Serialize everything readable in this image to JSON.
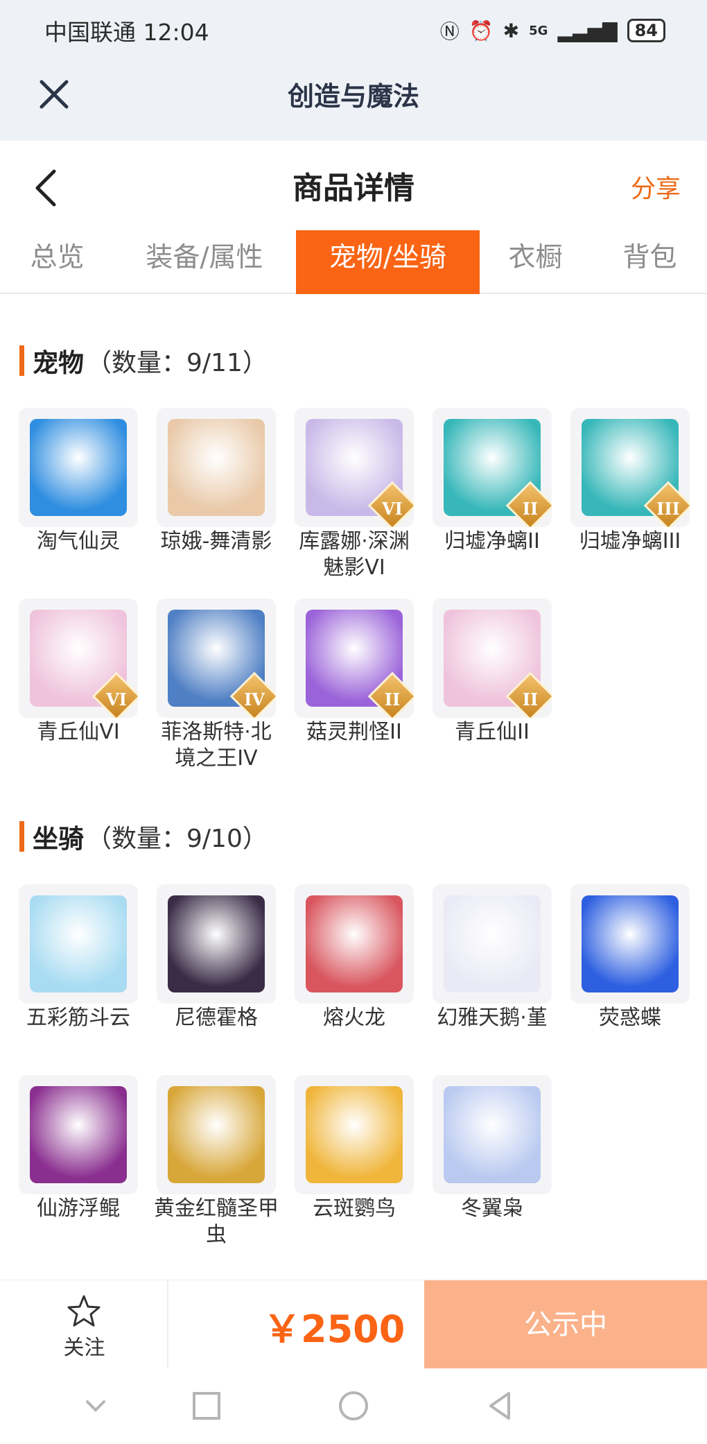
{
  "status_bar": {
    "carrier": "中国联通 12:04",
    "network": "5G",
    "battery": "84"
  },
  "webview": {
    "title": "创造与魔法"
  },
  "header": {
    "title": "商品详情",
    "share_label": "分享"
  },
  "tabs": [
    {
      "label": "总览",
      "active": false
    },
    {
      "label": "装备/属性",
      "active": false
    },
    {
      "label": "宠物/坐骑",
      "active": true
    },
    {
      "label": "衣橱",
      "active": false
    },
    {
      "label": "背包",
      "active": false
    }
  ],
  "pets": {
    "title": "宠物",
    "count": "（数量：9/11）",
    "items": [
      {
        "name": "淘气仙灵",
        "icon": "blue-puppy-icon",
        "color": "#2f8ee0",
        "tier": ""
      },
      {
        "name": "琼娥-舞清影",
        "icon": "fairy-girl-icon",
        "color": "#e9c9a8",
        "tier": ""
      },
      {
        "name": "库露娜·深渊魅影VI",
        "icon": "white-hair-girl-icon",
        "color": "#c9b9e8",
        "tier": "VI"
      },
      {
        "name": "归墟净螭II",
        "icon": "teal-dragon-icon",
        "color": "#37b7b9",
        "tier": "II"
      },
      {
        "name": "归墟净螭III",
        "icon": "teal-dragon-icon",
        "color": "#37b7b9",
        "tier": "III"
      },
      {
        "name": "青丘仙VI",
        "icon": "fox-girl-icon",
        "color": "#efc3dc",
        "tier": "VI"
      },
      {
        "name": "菲洛斯特·北境之王IV",
        "icon": "ice-dragon-icon",
        "color": "#4f7fc4",
        "tier": "IV"
      },
      {
        "name": "菇灵荆怪II",
        "icon": "purple-mushroom-icon",
        "color": "#9b63d9",
        "tier": "II"
      },
      {
        "name": "青丘仙II",
        "icon": "fox-girl-icon",
        "color": "#efc3dc",
        "tier": "II"
      }
    ]
  },
  "mounts": {
    "title": "坐骑",
    "count": "（数量：9/10）",
    "items": [
      {
        "name": "五彩筋斗云",
        "icon": "cloud-icon",
        "color": "#a9dcf2",
        "tier": ""
      },
      {
        "name": "尼德霍格",
        "icon": "black-dragon-icon",
        "color": "#3a2b46",
        "tier": ""
      },
      {
        "name": "熔火龙",
        "icon": "red-dragon-icon",
        "color": "#d9565f",
        "tier": ""
      },
      {
        "name": "幻雅天鹅·堇",
        "icon": "swan-icon",
        "color": "#e9eaf5",
        "tier": ""
      },
      {
        "name": "荧惑蝶",
        "icon": "blue-butterfly-icon",
        "color": "#2d5fe0",
        "tier": ""
      },
      {
        "name": "仙游浮鲲",
        "icon": "purple-fish-icon",
        "color": "#8a2f8f",
        "tier": ""
      },
      {
        "name": "黄金红髓圣甲虫",
        "icon": "golden-beetle-icon",
        "color": "#d8a73a",
        "tier": ""
      },
      {
        "name": "云斑鹦鸟",
        "icon": "parrot-icon",
        "color": "#f0b63c",
        "tier": ""
      },
      {
        "name": "冬翼枭",
        "icon": "snow-owl-icon",
        "color": "#b9c9f0",
        "tier": ""
      }
    ]
  },
  "footer": {
    "follow_label": "关注",
    "price": "￥2500",
    "status_label": "公示中"
  },
  "colors": {
    "accent": "#fa6414",
    "status_button": "#fbb28a"
  }
}
